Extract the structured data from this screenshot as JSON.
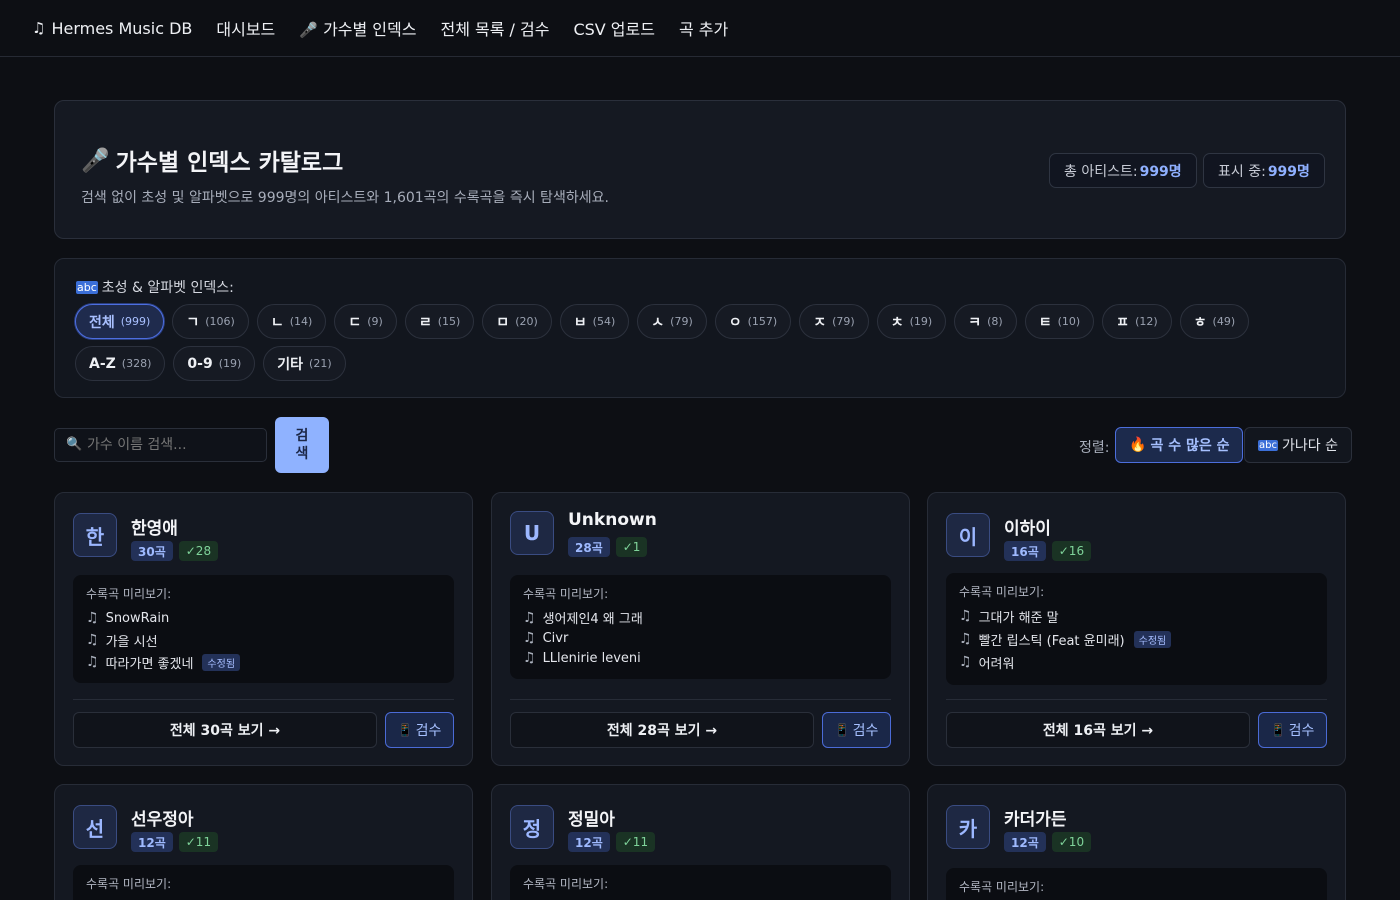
{
  "nav": {
    "brand_icon": "music-note-icon",
    "brand": "Hermes Music DB",
    "items": [
      {
        "label": "대시보드"
      },
      {
        "label": "가수별 인덱스",
        "icon": "microphone-icon"
      },
      {
        "label": "전체 목록 / 검수"
      },
      {
        "label": "CSV 업로드"
      },
      {
        "label": "곡 추가"
      }
    ]
  },
  "hero": {
    "icon": "microphone-icon",
    "title": "가수별 인덱스 카탈로그",
    "subtitle": "검색 없이 초성 및 알파벳으로 999명의 아티스트와 1,601곡의 수록곡을 즉시 탐색하세요.",
    "total_label": "총 아티스트:",
    "total_value": "999명",
    "showing_label": "표시 중:",
    "showing_value": "999명"
  },
  "index": {
    "icon": "abc-icon",
    "label": "초성 & 알파벳 인덱스:",
    "chips": [
      {
        "label": "전체",
        "count": "(999)"
      },
      {
        "label": "ㄱ",
        "count": "(106)"
      },
      {
        "label": "ㄴ",
        "count": "(14)"
      },
      {
        "label": "ㄷ",
        "count": "(9)"
      },
      {
        "label": "ㄹ",
        "count": "(15)"
      },
      {
        "label": "ㅁ",
        "count": "(20)"
      },
      {
        "label": "ㅂ",
        "count": "(54)"
      },
      {
        "label": "ㅅ",
        "count": "(79)"
      },
      {
        "label": "ㅇ",
        "count": "(157)"
      },
      {
        "label": "ㅈ",
        "count": "(79)"
      },
      {
        "label": "ㅊ",
        "count": "(19)"
      },
      {
        "label": "ㅋ",
        "count": "(8)"
      },
      {
        "label": "ㅌ",
        "count": "(10)"
      },
      {
        "label": "ㅍ",
        "count": "(12)"
      },
      {
        "label": "ㅎ",
        "count": "(49)"
      },
      {
        "label": "A-Z",
        "count": "(328)"
      },
      {
        "label": "0-9",
        "count": "(19)"
      },
      {
        "label": "기타",
        "count": "(21)"
      }
    ]
  },
  "search": {
    "placeholder": "가수 이름 검색...",
    "button": "검\n색"
  },
  "sort": {
    "label": "정렬:",
    "by_count": "곡 수 많은 순",
    "by_name": "가나다 순"
  },
  "cards": [
    {
      "initial": "한",
      "name": "한영애",
      "count": "30곡",
      "verified": "✓28",
      "preview_label": "수록곡 미리보기:",
      "songs": [
        {
          "title": "SnowRain"
        },
        {
          "title": "가을 시선"
        },
        {
          "title": "따라가면 좋겠네",
          "badge": "수정됨"
        }
      ],
      "view_all": "전체 30곡 보기 →",
      "review": "검수"
    },
    {
      "initial": "U",
      "name": "Unknown",
      "count": "28곡",
      "verified": "✓1",
      "preview_label": "수록곡 미리보기:",
      "songs": [
        {
          "title": "생어제인4 왜 그래"
        },
        {
          "title": "Civr"
        },
        {
          "title": "LLlenirie leveni"
        }
      ],
      "view_all": "전체 28곡 보기 →",
      "review": "검수"
    },
    {
      "initial": "이",
      "name": "이하이",
      "count": "16곡",
      "verified": "✓16",
      "preview_label": "수록곡 미리보기:",
      "songs": [
        {
          "title": "그대가 해준 말"
        },
        {
          "title": "빨간 립스틱 (Feat 윤미래)",
          "badge": "수정됨"
        },
        {
          "title": "어려워"
        }
      ],
      "view_all": "전체 16곡 보기 →",
      "review": "검수"
    },
    {
      "initial": "선",
      "name": "선우정아",
      "count": "12곡",
      "verified": "✓11",
      "preview_label": "수록곡 미리보기:"
    },
    {
      "initial": "정",
      "name": "정밀아",
      "count": "12곡",
      "verified": "✓11",
      "preview_label": "수록곡 미리보기:"
    },
    {
      "initial": "카",
      "name": "카더가든",
      "count": "12곡",
      "verified": "✓10",
      "preview_label": "수록곡 미리보기:"
    }
  ]
}
